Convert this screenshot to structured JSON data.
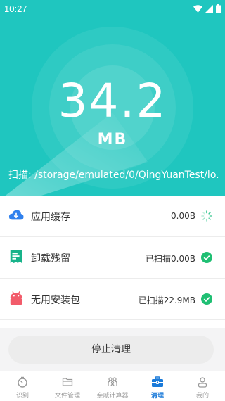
{
  "status_bar": {
    "time": "10:27"
  },
  "scan": {
    "size_value": "34.2",
    "size_unit": "MB",
    "path_text": "扫描: /storage/emulated/0/QingYuanTest/lo..."
  },
  "items": [
    {
      "label": "应用缓存",
      "value": "0.00B",
      "state": "scanning",
      "icon": "cloud-download-icon",
      "icon_color": "#2f80ed"
    },
    {
      "label": "卸载残留",
      "value": "已扫描0.00B",
      "state": "done",
      "icon": "receipt-icon",
      "icon_color": "#18b38a"
    },
    {
      "label": "无用安装包",
      "value": "已扫描22.9MB",
      "state": "done",
      "icon": "android-icon",
      "icon_color": "#f25b6a"
    }
  ],
  "stop_button": {
    "label": "停止清理"
  },
  "tabs": [
    {
      "label": "识别",
      "icon": "timer-icon",
      "active": false
    },
    {
      "label": "文件管理",
      "icon": "folder-icon",
      "active": false
    },
    {
      "label": "亲戚计算器",
      "icon": "family-icon",
      "active": false
    },
    {
      "label": "清理",
      "icon": "toolbox-icon",
      "active": true
    },
    {
      "label": "我的",
      "icon": "person-icon",
      "active": false
    }
  ],
  "colors": {
    "hero_bg": "#1fc6bf",
    "check_green": "#1fbf73",
    "active_tab": "#1a7ad9"
  }
}
